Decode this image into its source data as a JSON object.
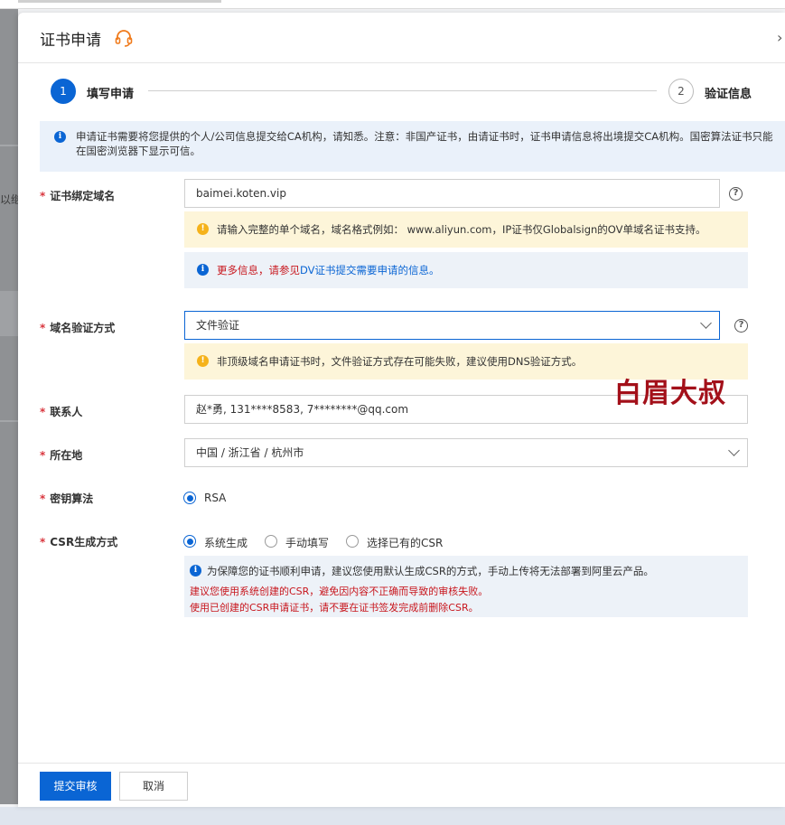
{
  "background": {
    "left_partial_text": "以继"
  },
  "drawer": {
    "title": "证书申请",
    "headset_icon": "headset-icon",
    "close_icon": "›"
  },
  "steps": [
    {
      "number": "1",
      "label": "填写申请",
      "active": true
    },
    {
      "number": "2",
      "label": "验证信息",
      "active": false
    }
  ],
  "notice": {
    "text": "申请证书需要将您提供的个人/公司信息提交给CA机构，请知悉。注意：非国产证书，由请证书时，证书申请信息将出境提交CA机构。国密算法证书只能在国密浏览器下显示可信。"
  },
  "form": {
    "domain": {
      "label": "证书绑定域名",
      "value": "baimei.koten.vip",
      "warn_tip": "请输入完整的单个域名，域名格式例如： www.aliyun.com，IP证书仅Globalsign的OV单域名证书支持。",
      "info_prefix": "更多信息，请参见",
      "info_link": "DV证书提交需要申请的信息。"
    },
    "verify": {
      "label": "域名验证方式",
      "value": "文件验证",
      "warn_tip": "非顶级域名申请证书时，文件验证方式存在可能失败，建议使用DNS验证方式。"
    },
    "contact": {
      "label": "联系人",
      "value": "赵*勇, 131****8583, 7********@qq.com"
    },
    "location": {
      "label": "所在地",
      "value": "中国 / 浙江省 / 杭州市"
    },
    "algorithm": {
      "label": "密钥算法",
      "option": "RSA"
    },
    "csr": {
      "label": "CSR生成方式",
      "options": [
        "系统生成",
        "手动填写",
        "选择已有的CSR"
      ],
      "selected": "系统生成",
      "tip1": "为保障您的证书顺利申请，建议您使用默认生成CSR的方式，手动上传将无法部署到阿里云产品。",
      "tip2": "建议您使用系统创建的CSR，避免因内容不正确而导致的审核失败。",
      "tip3": "使用已创建的CSR申请证书，请不要在证书签发完成前删除CSR。"
    }
  },
  "watermark": "白眉大叔",
  "footer": {
    "submit": "提交审核",
    "cancel": "取消"
  },
  "colors": {
    "primary": "#0a65d4",
    "warn_bg": "#fdf5d9",
    "info_bg": "#edf2f8",
    "error_text": "#c8161d"
  }
}
